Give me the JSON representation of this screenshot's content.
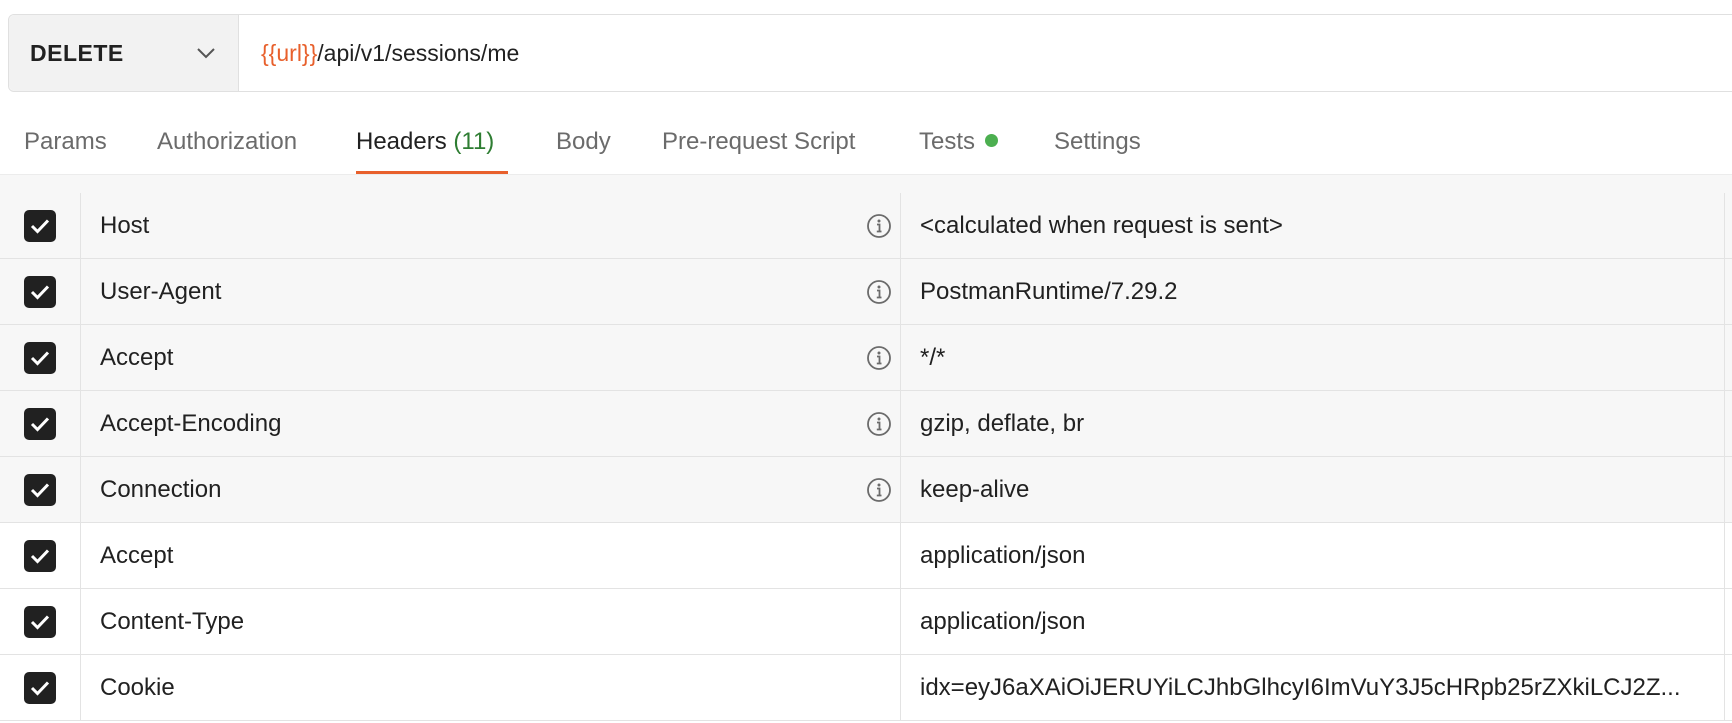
{
  "request": {
    "method": "DELETE",
    "url_variable": "{{url}}",
    "url_path": "/api/v1/sessions/me"
  },
  "tabs": [
    {
      "label": "Params"
    },
    {
      "label": "Authorization"
    },
    {
      "label": "Headers",
      "count": "(11)"
    },
    {
      "label": "Body"
    },
    {
      "label": "Pre-request Script"
    },
    {
      "label": "Tests"
    },
    {
      "label": "Settings"
    }
  ],
  "colors": {
    "accent": "#e8602c",
    "count_green": "#2e7d32",
    "tests_dot": "#4caf50"
  },
  "headers": [
    {
      "key": "Host",
      "value": "<calculated when request is sent>",
      "checked": true,
      "auto": true
    },
    {
      "key": "User-Agent",
      "value": "PostmanRuntime/7.29.2",
      "checked": true,
      "auto": true
    },
    {
      "key": "Accept",
      "value": "*/*",
      "checked": true,
      "auto": true
    },
    {
      "key": "Accept-Encoding",
      "value": "gzip, deflate, br",
      "checked": true,
      "auto": true
    },
    {
      "key": "Connection",
      "value": "keep-alive",
      "checked": true,
      "auto": true
    },
    {
      "key": "Accept",
      "value": "application/json",
      "checked": true,
      "auto": false
    },
    {
      "key": "Content-Type",
      "value": "application/json",
      "checked": true,
      "auto": false
    },
    {
      "key": "Cookie",
      "value": "idx=eyJ6aXAiOiJERUYiLCJhbGlhcyI6ImVuY3J5cHRpb25rZXkiLCJ2Z...",
      "checked": true,
      "auto": false
    }
  ]
}
